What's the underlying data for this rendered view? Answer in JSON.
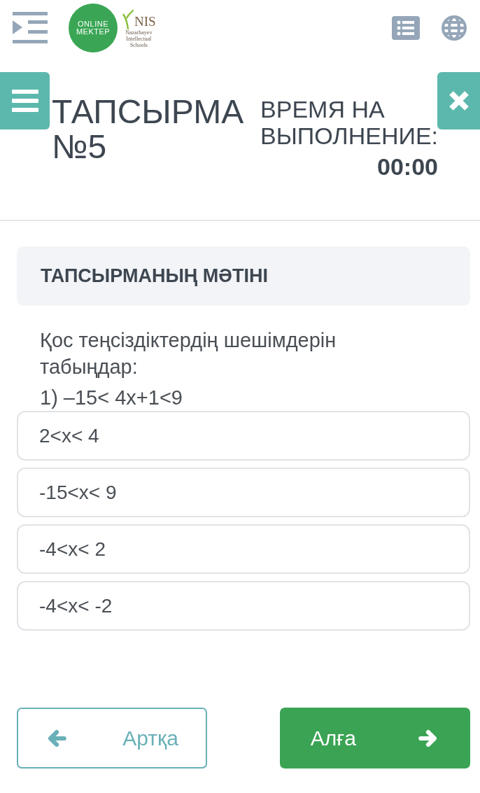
{
  "header": {
    "logo_circle": [
      "ONLINE",
      "MEKTEP"
    ],
    "logo_brand": "NIS",
    "logo_caption": [
      "Nazarbayev",
      "Intellectual",
      "Schools"
    ]
  },
  "task": {
    "title": [
      "ТАПСЫРМА",
      "№5"
    ],
    "timer_label": [
      "ВРЕМЯ НА",
      "ВЫПОЛНЕНИЕ:"
    ],
    "timer_value": "00:00"
  },
  "section_heading": "ТАПСЫРМАНЫҢ МӘТІНІ",
  "question": [
    "Қос теңсіздіктердің шешімдерін табыңдар:",
    "1) –15< 4x+1<9"
  ],
  "options": [
    {
      "label": "2<x< 4"
    },
    {
      "label": "-15<x< 9"
    },
    {
      "label": "-4<x< 2"
    },
    {
      "label": "-4<x< -2"
    }
  ],
  "nav": [
    {
      "kind": "back",
      "label": "Артқа"
    },
    {
      "kind": "next",
      "label": "Алға"
    }
  ]
}
